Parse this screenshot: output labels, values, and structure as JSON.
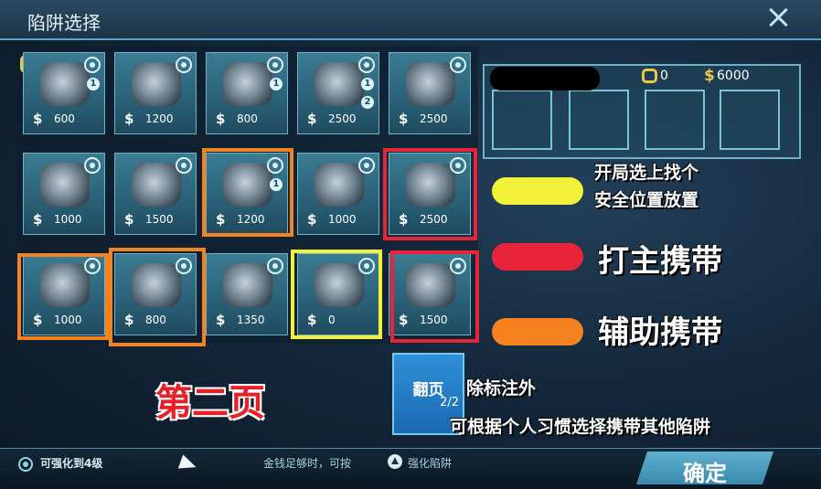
{
  "header": {
    "title": "陷阱选择"
  },
  "traps": [
    {
      "price": "600",
      "upgrade_levels": [
        "1"
      ]
    },
    {
      "price": "1200",
      "upgrade_levels": []
    },
    {
      "price": "800",
      "upgrade_levels": [
        "1"
      ]
    },
    {
      "price": "2500",
      "upgrade_levels": [
        "1",
        "2"
      ]
    },
    {
      "price": "2500",
      "upgrade_levels": []
    },
    {
      "price": "1000",
      "upgrade_levels": []
    },
    {
      "price": "1500",
      "upgrade_levels": []
    },
    {
      "price": "1200",
      "upgrade_levels": [
        "1"
      ]
    },
    {
      "price": "1000",
      "upgrade_levels": []
    },
    {
      "price": "2500",
      "upgrade_levels": []
    },
    {
      "price": "1000",
      "upgrade_levels": []
    },
    {
      "price": "800",
      "upgrade_levels": []
    },
    {
      "price": "1350",
      "upgrade_levels": []
    },
    {
      "price": "0",
      "upgrade_levels": []
    },
    {
      "price": "1500",
      "upgrade_levels": []
    }
  ],
  "currency_symbol": "$",
  "carry": {
    "currency_value": "0",
    "money_symbol": "$",
    "money_value": "6000"
  },
  "legend": {
    "yellow": "开局选上找个\n安全位置放置",
    "red": "打主携带",
    "orange": "辅助携带"
  },
  "colors": {
    "yellow": "#f3f03a",
    "red": "#e8243a",
    "orange": "#f5821f"
  },
  "page_label": "第二页",
  "page_button": {
    "label": "翻页",
    "count": "2/2"
  },
  "note": {
    "line1": "除标注外",
    "line2": "可根据个人习惯选择携带其他陷阱"
  },
  "footer": {
    "upgrade_hint": "可强化到4级",
    "hint_before": "金钱足够时，可按",
    "hint_after": "强化陷阱",
    "confirm": "确定"
  }
}
